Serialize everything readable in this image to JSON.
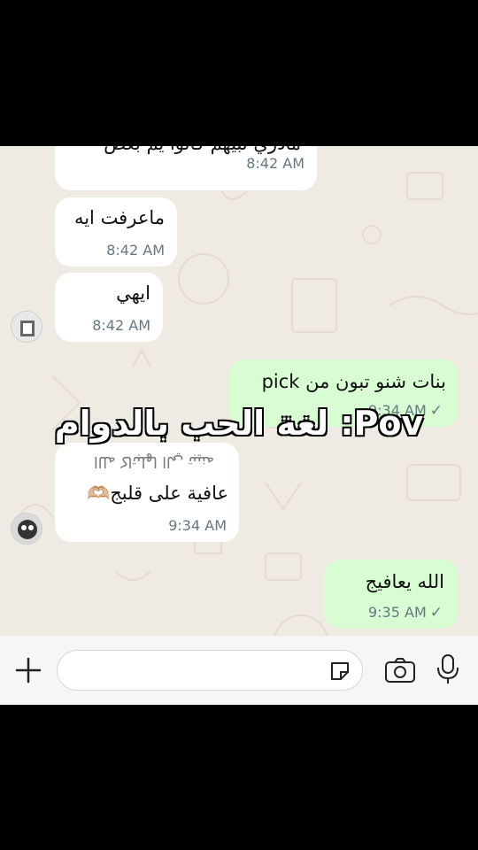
{
  "messages": [
    {
      "side": "in",
      "text": "مادري نبيهم كانوا يم بعض",
      "time": "8:42 AM"
    },
    {
      "side": "in",
      "text": "ماعرفت ايه",
      "time": "8:42 AM"
    },
    {
      "side": "in",
      "text": "ايهي",
      "time": "8:42 AM"
    },
    {
      "side": "out",
      "text": "بنات شنو تبون من pick",
      "time": "9:34 AM",
      "status": "sent"
    },
    {
      "side": "in",
      "text": "الله كاتبلها الي تبينه",
      "text2": "عافية على قلبج🫶🏼",
      "time": "9:34 AM"
    },
    {
      "side": "out",
      "text": "الله يعافيج",
      "time": "9:35 AM",
      "status": "sent"
    }
  ],
  "tick_glyph": "✓",
  "overlay_caption": "Pov: لغة الحب بالدوام",
  "composer": {
    "input_placeholder": ""
  },
  "icons": [
    "plus-icon",
    "sticker-icon",
    "camera-icon",
    "microphone-icon"
  ],
  "colors": {
    "incoming": "#ffffff",
    "outgoing": "#d9fdd3",
    "chat_bg": "#efeae2"
  }
}
